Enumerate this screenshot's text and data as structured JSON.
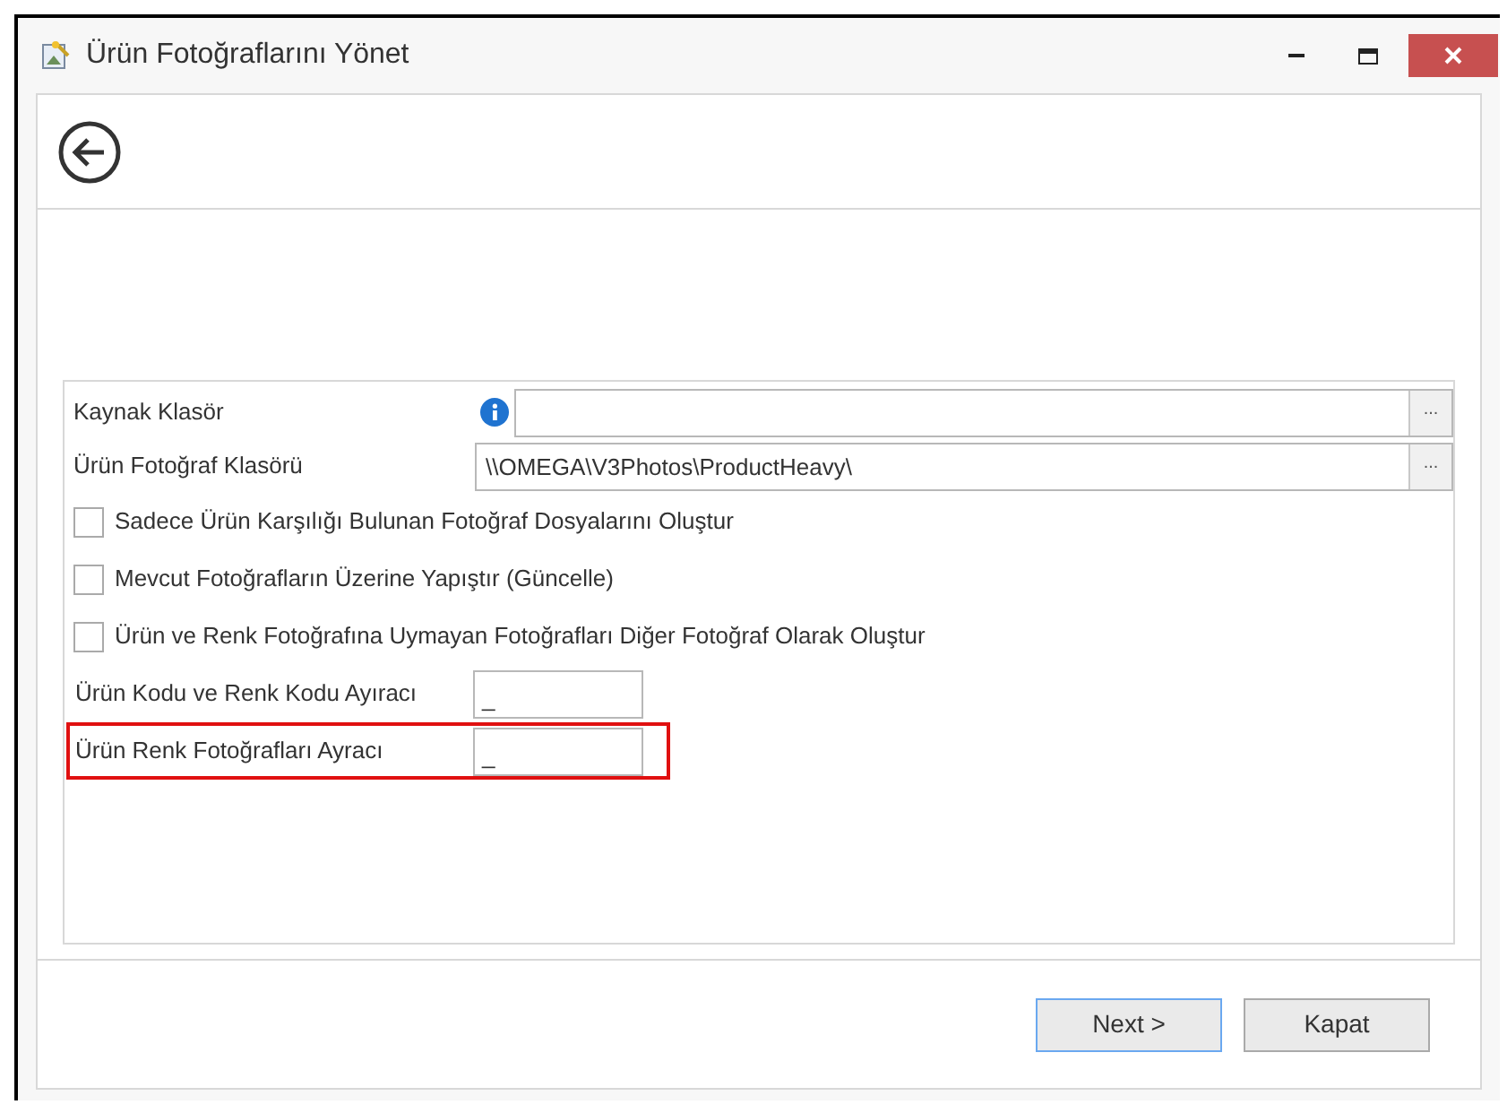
{
  "window": {
    "title": "Ürün Fotoğraflarını Yönet"
  },
  "path_fields": [
    {
      "label": "Kaynak Klasör",
      "info": true,
      "browse": "..."
    },
    {
      "label": "Ürün Fotoğraf Klasörü",
      "value": "\\\\OMEGA\\V3Photos\\ProductHeavy\\",
      "info": false,
      "browse": "..."
    }
  ],
  "checkboxes": [
    {
      "label": "Sadece Ürün Karşılığı Bulunan Fotoğraf Dosyalarını Oluştur",
      "checked": false
    },
    {
      "label": "Mevcut Fotoğrafların Üzerine Yapıştır (Güncelle)",
      "checked": false
    },
    {
      "label": "Ürün ve Renk Fotoğrafına Uymayan Fotoğrafları Diğer Fotoğraf Olarak Oluştur",
      "checked": false
    }
  ],
  "separators": [
    {
      "label": "Ürün Kodu ve Renk Kodu Ayıracı",
      "value": "_",
      "highlighted": false
    },
    {
      "label": "Ürün Renk Fotoğrafları Ayracı",
      "value": "_",
      "highlighted": true
    }
  ],
  "buttons": [
    {
      "label": "Next >",
      "selected": true
    },
    {
      "label": "Kapat",
      "selected": false
    }
  ]
}
